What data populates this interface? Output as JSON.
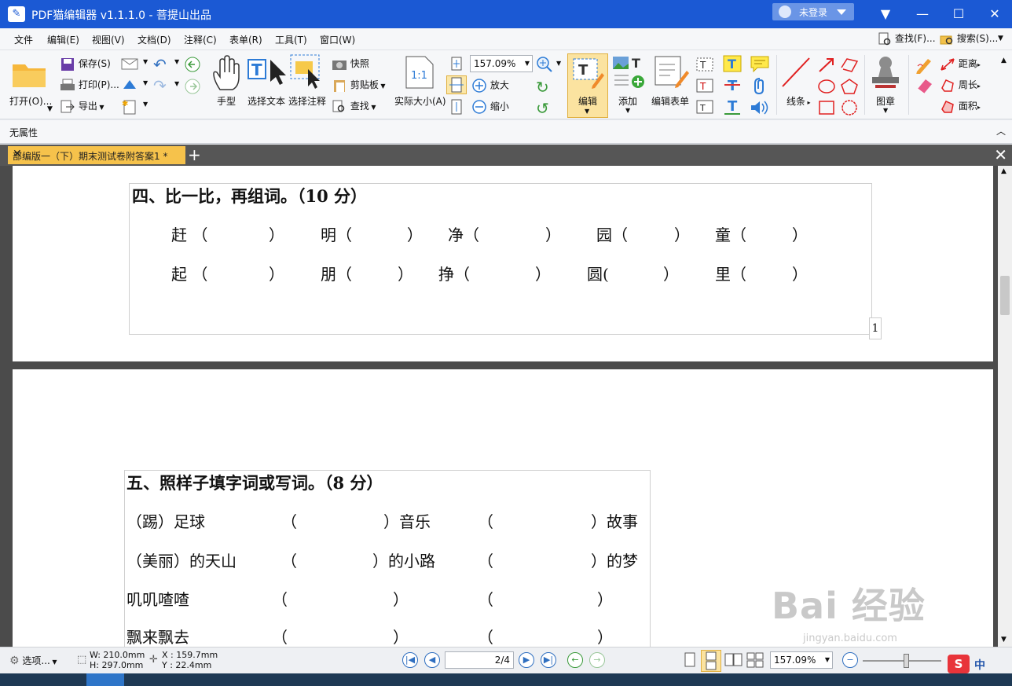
{
  "window": {
    "title": "PDF猫编辑器 v1.1.1.0 - 菩提山出品",
    "login_label": "未登录",
    "minimize": "—",
    "maximize": "☐",
    "close": "✕"
  },
  "menu": [
    "文件",
    "编辑(E)",
    "视图(V)",
    "文档(D)",
    "注释(C)",
    "表单(R)",
    "工具(T)",
    "窗口(W)"
  ],
  "top_right": {
    "find": "查找(F)...",
    "search": "搜索(S)..."
  },
  "ribbon": {
    "open": "打开(O)...",
    "save": "保存(S)",
    "print": "打印(P)...",
    "export": "导出",
    "hand": "手型",
    "select_text": "选择文本",
    "select_annot": "选择注释",
    "snapshot": "快照",
    "clipboard": "剪贴板",
    "find": "查找",
    "actual_size": "实际大小(A)",
    "zoom_value": "157.09%",
    "zoom_in": "放大",
    "zoom_out": "缩小",
    "edit": "编辑",
    "add": "添加",
    "edit_form": "编辑表单",
    "lines": "线条",
    "stamp": "图章",
    "distance": "距离",
    "perimeter": "周长",
    "area": "面积"
  },
  "property_bar": "无属性",
  "tab": {
    "label": "部编版一（下）期末测试卷附答案1 *",
    "close": "✕",
    "add": "+",
    "close_all": "✕"
  },
  "doc": {
    "q4": {
      "title": "四、比一比，再组词。（10 分）",
      "row1": [
        "赶 （",
        "）",
        "明（",
        "）",
        "净（",
        "）",
        "园（",
        "）",
        "童（",
        "）"
      ],
      "row2": [
        "起 （",
        "）",
        "朋（",
        "）",
        "挣（",
        "）",
        "圆(",
        "）",
        "里（",
        "）"
      ],
      "page_number": "1"
    },
    "q5": {
      "title": "五、照样子填字词或写词。（8 分）",
      "r1": [
        "（踢）足球",
        "（",
        "）音乐",
        "（",
        "）故事"
      ],
      "r2": [
        "（美丽）的天山",
        "（",
        "）的小路",
        "（",
        "）的梦"
      ],
      "r3": [
        "叽叽喳喳",
        "（",
        "）",
        "（",
        "）"
      ],
      "r4": [
        "飘来飘去",
        "（",
        "）",
        "（",
        "）"
      ]
    }
  },
  "status": {
    "options": "选项...",
    "w": "W: 210.0mm",
    "h": "H: 297.0mm",
    "x": "X : 159.7mm",
    "y": "Y :   22.4mm",
    "page": "2/4",
    "zoom": "157.09%"
  },
  "watermark": {
    "text": "Bai 经验",
    "sub": "jingyan.baidu.com"
  },
  "ime": "中"
}
